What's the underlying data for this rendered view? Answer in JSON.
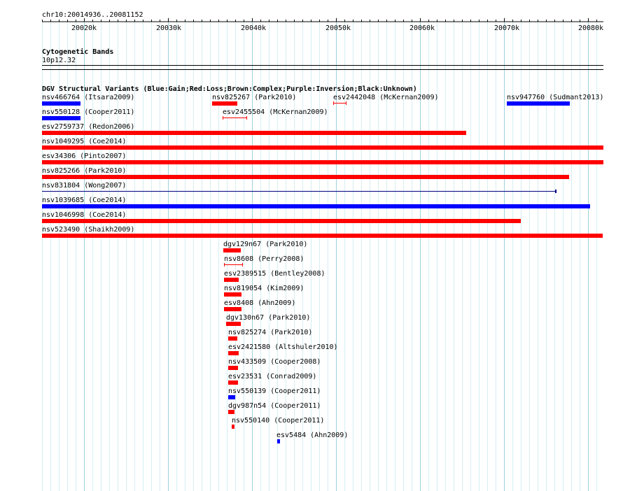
{
  "header": {
    "coords": "chr10:20014936..20081152"
  },
  "ruler": {
    "ticks": [
      "20020k",
      "20030k",
      "20040k",
      "20050k",
      "20060k",
      "20070k",
      "20080k"
    ]
  },
  "cytoband_track": {
    "title": "Cytogenetic Bands",
    "band": "10p12.32"
  },
  "dgv_track": {
    "title": "DGV Structural Variants (Blue:Gain;Red:Loss;Brown:Complex;Purple:Inversion;Black:Unknown)",
    "legend_colors": {
      "gain": "#0000ff",
      "loss": "#ff0000",
      "inversion_line": "#000080"
    }
  },
  "features": [
    {
      "id": "nsv466764",
      "study": "Itsara2009",
      "type": "gain"
    },
    {
      "id": "nsv825267",
      "study": "Park2010",
      "type": "loss"
    },
    {
      "id": "esv2442048",
      "study": "McKernan2009",
      "type": "loss"
    },
    {
      "id": "nsv947760",
      "study": "Sudmant2013",
      "type": "gain"
    },
    {
      "id": "nsv550128",
      "study": "Cooper2011",
      "type": "gain"
    },
    {
      "id": "esv2455504",
      "study": "McKernan2009",
      "type": "loss"
    },
    {
      "id": "esv2759737",
      "study": "Redon2006",
      "type": "loss"
    },
    {
      "id": "nsv1049295",
      "study": "Coe2014",
      "type": "loss"
    },
    {
      "id": "esv34306",
      "study": "Pinto2007",
      "type": "loss"
    },
    {
      "id": "nsv825266",
      "study": "Park2010",
      "type": "loss"
    },
    {
      "id": "nsv831804",
      "study": "Wong2007",
      "type": "gain"
    },
    {
      "id": "nsv1039685",
      "study": "Coe2014",
      "type": "gain"
    },
    {
      "id": "nsv1046998",
      "study": "Coe2014",
      "type": "loss"
    },
    {
      "id": "nsv523490",
      "study": "Shaikh2009",
      "type": "loss"
    },
    {
      "id": "dgv129n67",
      "study": "Park2010",
      "type": "loss"
    },
    {
      "id": "nsv8608",
      "study": "Perry2008",
      "type": "loss"
    },
    {
      "id": "esv2389515",
      "study": "Bentley2008",
      "type": "loss"
    },
    {
      "id": "nsv819054",
      "study": "Kim2009",
      "type": "loss"
    },
    {
      "id": "esv8408",
      "study": "Ahn2009",
      "type": "loss"
    },
    {
      "id": "dgv130n67",
      "study": "Park2010",
      "type": "loss"
    },
    {
      "id": "nsv825274",
      "study": "Park2010",
      "type": "loss"
    },
    {
      "id": "esv2421580",
      "study": "Altshuler2010",
      "type": "loss"
    },
    {
      "id": "nsv433509",
      "study": "Cooper2008",
      "type": "loss"
    },
    {
      "id": "esv23531",
      "study": "Conrad2009",
      "type": "loss"
    },
    {
      "id": "nsv550139",
      "study": "Cooper2011",
      "type": "gain"
    },
    {
      "id": "dgv987n54",
      "study": "Cooper2011",
      "type": "loss"
    },
    {
      "id": "nsv550140",
      "study": "Cooper2011",
      "type": "loss"
    },
    {
      "id": "esv5484",
      "study": "Ahn2009",
      "type": "gain"
    }
  ]
}
